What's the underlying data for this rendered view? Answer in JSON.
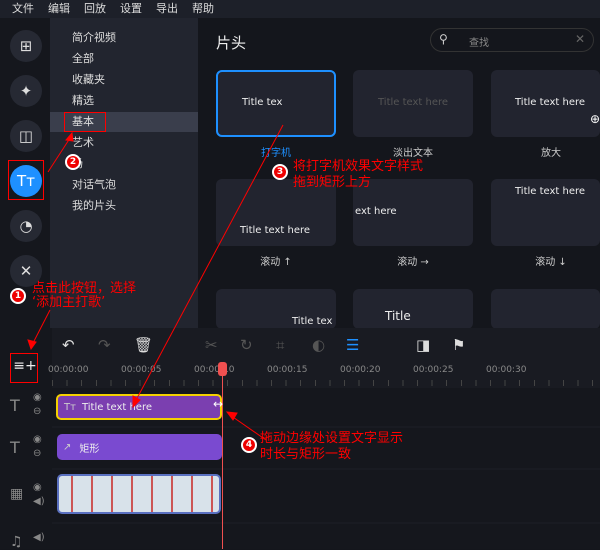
{
  "menu": [
    "文件",
    "编辑",
    "回放",
    "设置",
    "导出",
    "帮助"
  ],
  "rail": [
    {
      "icon": "add-media-icon",
      "g": "⊞"
    },
    {
      "icon": "magic-wand-icon",
      "g": "✦"
    },
    {
      "icon": "transition-icon",
      "g": "◫"
    },
    {
      "icon": "titles-icon",
      "g": "Tт"
    },
    {
      "icon": "sticker-icon",
      "g": "◔"
    },
    {
      "icon": "tools-icon",
      "g": "✕"
    }
  ],
  "categories": [
    "简介视频",
    "全部",
    "收藏夹",
    "精选",
    "基本",
    "艺术",
    "场",
    "对话气泡",
    "我的片头"
  ],
  "content": {
    "title": "片头",
    "search_placeholder": "查找",
    "cards": [
      {
        "preview": "Title tex",
        "label": "打字机"
      },
      {
        "preview": "Title text here",
        "label": "淡出文本"
      },
      {
        "preview": "Title text here",
        "label": "放大"
      },
      {
        "preview": "Title text here",
        "label": "滚动 ↑"
      },
      {
        "preview": "ext here",
        "label": "滚动 →"
      },
      {
        "preview": "Title text here",
        "label": "滚动 ↓"
      },
      {
        "preview": "Title tex",
        "label": ""
      },
      {
        "preview": "Title",
        "label": ""
      },
      {
        "preview": "",
        "label": ""
      }
    ]
  },
  "timeline": {
    "ruler": [
      "00:00:00",
      "00:00:05",
      "00:00:10",
      "00:00:15",
      "00:00:20",
      "00:00:25",
      "00:00:30"
    ],
    "clips": {
      "title": "Title text here",
      "shape": "矩形"
    }
  },
  "annotations": {
    "a1": "点击此按钮，选择\n‘添加主打歌’",
    "a3": "将打字机效果文字样式\n拖到矩形上方",
    "a4": "拖动边缘处设置文字显示\n时长与矩形一致",
    "n1": "1",
    "n2": "2",
    "n3": "3",
    "n4": "4"
  },
  "colors": {
    "accent": "#1e90ff",
    "title_clip": "#7b3fb0",
    "shape_clip": "#7a4ad0",
    "playhead": "#f05050",
    "annotation": "#ff0000"
  }
}
